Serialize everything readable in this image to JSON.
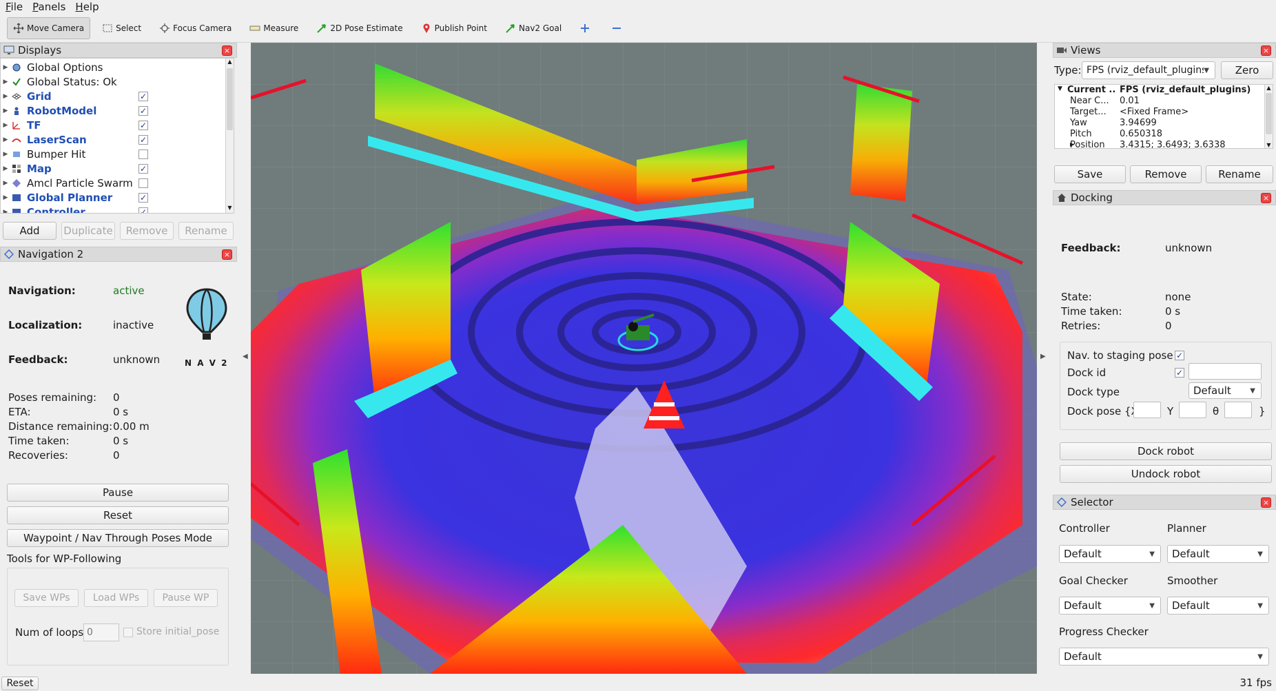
{
  "menu": [
    "File",
    "Panels",
    "Help"
  ],
  "toolbar": {
    "move_camera": "Move Camera",
    "select": "Select",
    "focus_camera": "Focus Camera",
    "measure": "Measure",
    "pose_estimate": "2D Pose Estimate",
    "publish_point": "Publish Point",
    "nav2_goal": "Nav2 Goal"
  },
  "displays": {
    "title": "Displays",
    "items": [
      {
        "label": "Global Options",
        "bold": false,
        "checkbox": null
      },
      {
        "label": "Global Status: Ok",
        "bold": false,
        "checkbox": null
      },
      {
        "label": "Grid",
        "bold": true,
        "checkbox": true
      },
      {
        "label": "RobotModel",
        "bold": true,
        "checkbox": true
      },
      {
        "label": "TF",
        "bold": true,
        "checkbox": true
      },
      {
        "label": "LaserScan",
        "bold": true,
        "checkbox": true
      },
      {
        "label": "Bumper Hit",
        "bold": false,
        "checkbox": false
      },
      {
        "label": "Map",
        "bold": true,
        "checkbox": true
      },
      {
        "label": "Amcl Particle Swarm",
        "bold": false,
        "checkbox": false
      },
      {
        "label": "Global Planner",
        "bold": true,
        "checkbox": true
      },
      {
        "label": "Controller",
        "bold": true,
        "checkbox": true
      }
    ],
    "buttons": {
      "add": "Add",
      "duplicate": "Duplicate",
      "remove": "Remove",
      "rename": "Rename"
    }
  },
  "nav2": {
    "title": "Navigation 2",
    "navigation_label": "Navigation:",
    "navigation_value": "active",
    "localization_label": "Localization:",
    "localization_value": "inactive",
    "feedback_label": "Feedback:",
    "feedback_value": "unknown",
    "logo_text": "N A V 2",
    "poses_remaining_label": "Poses remaining:",
    "poses_remaining_value": "0",
    "eta_label": "ETA:",
    "eta_value": "0 s",
    "distance_label": "Distance remaining:",
    "distance_value": "0.00 m",
    "time_label": "Time taken:",
    "time_value": "0 s",
    "recoveries_label": "Recoveries:",
    "recoveries_value": "0",
    "pause": "Pause",
    "reset": "Reset",
    "waypoint_mode": "Waypoint / Nav Through Poses Mode",
    "tools_label": "Tools for WP-Following",
    "save_wps": "Save WPs",
    "load_wps": "Load WPs",
    "pause_wp": "Pause WP",
    "num_loops_label": "Num of loops",
    "num_loops_value": "0",
    "store_initial_pose": "Store initial_pose"
  },
  "views": {
    "title": "Views",
    "type_label": "Type:",
    "type_value": "FPS (rviz_default_plugins",
    "zero": "Zero",
    "rows": [
      {
        "key": "Current ...",
        "value": "FPS (rviz_default_plugins)",
        "bold": true
      },
      {
        "key": "Near C...",
        "value": "0.01",
        "bold": false
      },
      {
        "key": "Target...",
        "value": "<Fixed Frame>",
        "bold": false
      },
      {
        "key": "Yaw",
        "value": "3.94699",
        "bold": false
      },
      {
        "key": "Pitch",
        "value": "0.650318",
        "bold": false
      },
      {
        "key": "Position",
        "value": "3.4315; 3.6493; 3.6338",
        "bold": false
      }
    ],
    "save": "Save",
    "remove": "Remove",
    "rename": "Rename"
  },
  "docking": {
    "title": "Docking",
    "feedback_label": "Feedback:",
    "feedback_value": "unknown",
    "state_label": "State:",
    "state_value": "none",
    "time_label": "Time taken:",
    "time_value": "0 s",
    "retries_label": "Retries:",
    "retries_value": "0",
    "nav_staging_label": "Nav. to staging pose",
    "dock_id_label": "Dock id",
    "dock_type_label": "Dock type",
    "dock_type_value": "Default",
    "dock_pose_label": "Dock pose {X",
    "y_label": "Y",
    "theta_label": "θ",
    "close_brace": "}",
    "dock_robot": "Dock robot",
    "undock_robot": "Undock robot"
  },
  "selector": {
    "title": "Selector",
    "controller_label": "Controller",
    "controller_value": "Default",
    "planner_label": "Planner",
    "planner_value": "Default",
    "goal_checker_label": "Goal Checker",
    "goal_checker_value": "Default",
    "smoother_label": "Smoother",
    "smoother_value": "Default",
    "progress_checker_label": "Progress Checker",
    "progress_checker_value": "Default"
  },
  "statusbar": {
    "reset": "Reset",
    "fps": "31 fps"
  },
  "colors": {
    "accent_blue": "#1f4fb4",
    "active_green": "#1f7a1f",
    "close_red": "#e44444",
    "viewport_bg": "#6f7b7b"
  }
}
